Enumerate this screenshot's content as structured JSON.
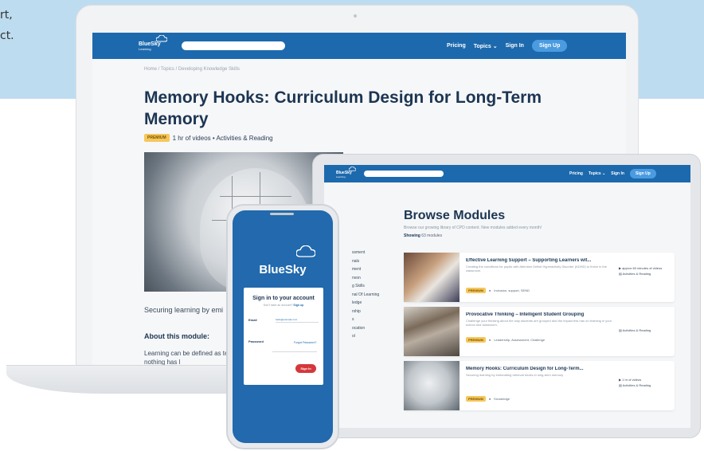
{
  "background": {
    "lines": [
      "rt,",
      "ct."
    ]
  },
  "laptop": {
    "nav": {
      "brand": "BlueSky",
      "brand_sub": "Learning",
      "links": [
        "Pricing",
        "Topics ⌄",
        "Sign In"
      ],
      "signup": "Sign Up"
    },
    "breadcrumb": "Home / Topics / Developing Knowledge Skills",
    "title": "Memory Hooks: Curriculum Design for Long-Term Memory",
    "badge": "PREMIUM",
    "meta": "1 hr of videos • Activities & Reading",
    "description": "Securing learning by emi",
    "about_heading": "About this module:",
    "about_body": "Learning can be defined as term memory, nothing has l"
  },
  "tablet": {
    "nav": {
      "brand": "BlueSky",
      "brand_sub": "Learning",
      "links": [
        "Pricing",
        "Topics ⌄",
        "Sign In"
      ],
      "signup": "Sign Up"
    },
    "title": "Browse Modules",
    "subtitle": "Browse our growing library of CPD content. New modules added every month!",
    "count_label": "Showing",
    "count_value": "63 modules",
    "sidebar": [
      "ssment",
      "nals",
      "ment",
      "nvon",
      "g Skills",
      "nal Of Learning",
      "ledge",
      "rship",
      "s",
      "ocation",
      "ol"
    ],
    "cards": [
      {
        "title": "Effective Learning Support – Supporting Learners wit...",
        "desc": "Creating the conditions for pupils with Attention Deficit Hyperactivity Disorder (ADHD) to thrive in the classroom.",
        "badge": "PREMIUM",
        "tags": "Inclusion, support, SEND",
        "side": [
          "approx 60 minutes of videos",
          "Activities & Reading"
        ]
      },
      {
        "title": "Provocative Thinking – Intelligent Student Grouping",
        "desc": "Challenge your thinking about the way students are grouped and the impact this has on learning in your school and classroom.",
        "badge": "PREMIUM",
        "tags": "Leadership, Assessment, Challenge",
        "side": [
          "Activities & Reading"
        ]
      },
      {
        "title": "Memory Hooks: Curriculum Design for Long-Term...",
        "desc": "Securing learning by embedding retrieval hooks in long-term memory",
        "badge": "PREMIUM",
        "tags": "Knowledge",
        "side": [
          "1 hr of videos",
          "Activities & Reading"
        ]
      }
    ]
  },
  "phone": {
    "brand": "BlueSky",
    "heading": "Sign in to your account",
    "sub_prefix": "Don't have an account?",
    "sub_link": "Sign up",
    "email_label": "Email",
    "email_value": "hello@example.com",
    "password_label": "Password",
    "forgot": "Forgot Password?",
    "button": "Sign In"
  },
  "colors": {
    "brand_blue": "#1d69ad",
    "premium": "#f6c75b",
    "signin_red": "#d4383b",
    "band": "#bedcf0"
  }
}
